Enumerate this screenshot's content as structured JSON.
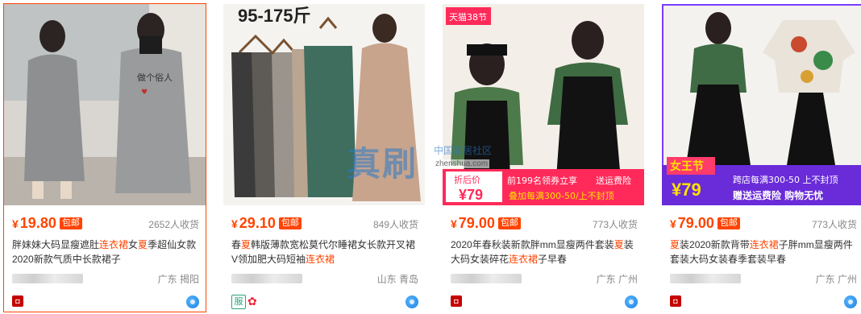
{
  "products": [
    {
      "id": "p1",
      "price": "19.80",
      "currency": "¥",
      "badge": "包邮",
      "sold": "2652人收货",
      "title_parts": [
        {
          "t": "胖妹妹大码显瘦遮肚",
          "hl": false
        },
        {
          "t": "连衣裙",
          "hl": true
        },
        {
          "t": "女",
          "hl": false
        },
        {
          "t": "夏",
          "hl": true
        },
        {
          "t": "季超仙女款2020新款气质中长款裙子",
          "hl": false
        }
      ],
      "location": "广东 揭阳",
      "extra_icons": []
    },
    {
      "id": "p2",
      "price": "29.10",
      "currency": "¥",
      "badge": "包邮",
      "sold": "849人收货",
      "overlay_text": "95-175斤",
      "title_parts": [
        {
          "t": "春",
          "hl": false
        },
        {
          "t": "夏",
          "hl": true
        },
        {
          "t": "韩版薄款宽松莫代尔睡裙女长款开叉裙V领加肥大码短袖",
          "hl": false
        },
        {
          "t": "连衣裙",
          "hl": true
        }
      ],
      "location": "山东 青岛",
      "extra_icons": [
        "服",
        "✿"
      ]
    },
    {
      "id": "p3",
      "price": "79.00",
      "currency": "¥",
      "badge": "包邮",
      "sold": "773人收货",
      "overlay": {
        "tmall_tag": "天猫38节",
        "discount_label": "折后价",
        "discount_price": "¥79",
        "coupon": "前199名领券立享",
        "shipping": "送运费险",
        "promo": "叠加每满300-50/上不封顶"
      },
      "title_parts": [
        {
          "t": "2020年春秋装新款胖mm显瘦两件套装",
          "hl": false
        },
        {
          "t": "夏",
          "hl": true
        },
        {
          "t": "装大码女装碎花",
          "hl": false
        },
        {
          "t": "连衣裙",
          "hl": true
        },
        {
          "t": "子早春",
          "hl": false
        }
      ],
      "location": "广东 广州",
      "extra_icons": []
    },
    {
      "id": "p4",
      "price": "79.00",
      "currency": "¥",
      "badge": "包邮",
      "sold": "773人收货",
      "overlay": {
        "festival": "女王节",
        "price": "¥79",
        "cross_store": "跨店每满300-50 上不封顶",
        "gift": "赠送运费险 购物无忧"
      },
      "title_parts": [
        {
          "t": "夏",
          "hl": true
        },
        {
          "t": "装2020新款背带",
          "hl": false
        },
        {
          "t": "连衣裙",
          "hl": true
        },
        {
          "t": "子胖mm显瘦两件套装大码女装春季套装早春",
          "hl": false
        }
      ],
      "location": "广东 广州",
      "extra_icons": []
    }
  ],
  "watermark": {
    "big": "真刷",
    "small": "中国家居社区",
    "url": "zhenshua.com"
  },
  "colors": {
    "accent": "#ff4400",
    "text": "#333333",
    "muted": "#888888"
  }
}
